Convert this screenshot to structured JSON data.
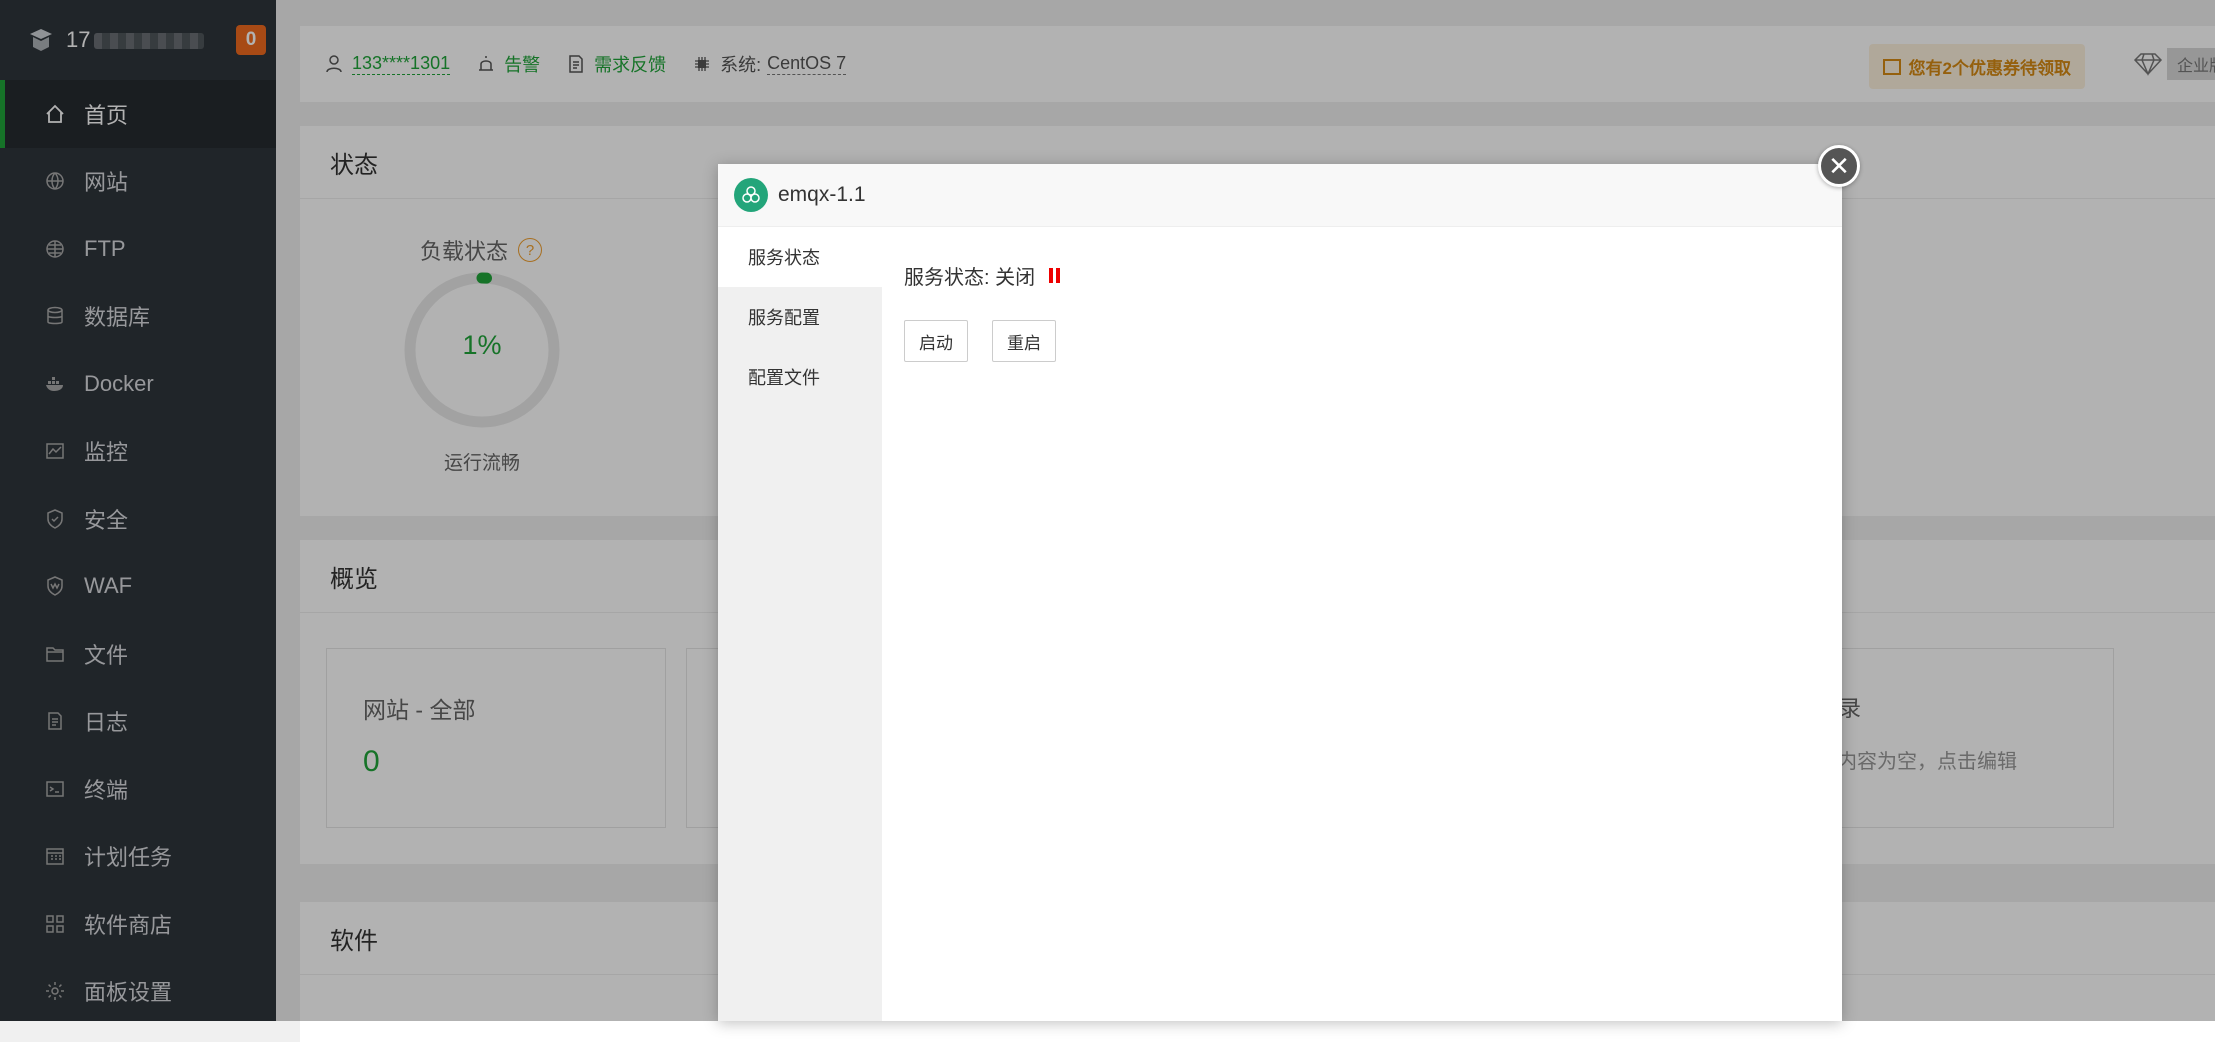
{
  "sidebar": {
    "account_prefix": "17",
    "notification_count": "0",
    "items": [
      {
        "label": "首页",
        "icon": "home-icon"
      },
      {
        "label": "网站",
        "icon": "globe-icon"
      },
      {
        "label": "FTP",
        "icon": "ftp-globe-icon"
      },
      {
        "label": "数据库",
        "icon": "database-icon"
      },
      {
        "label": "Docker",
        "icon": "docker-icon"
      },
      {
        "label": "监控",
        "icon": "monitor-icon"
      },
      {
        "label": "安全",
        "icon": "shield-icon"
      },
      {
        "label": "WAF",
        "icon": "waf-shield-icon"
      },
      {
        "label": "文件",
        "icon": "folder-icon"
      },
      {
        "label": "日志",
        "icon": "log-icon"
      },
      {
        "label": "终端",
        "icon": "terminal-icon"
      },
      {
        "label": "计划任务",
        "icon": "calendar-icon"
      },
      {
        "label": "软件商店",
        "icon": "apps-icon"
      },
      {
        "label": "面板设置",
        "icon": "gear-icon"
      }
    ]
  },
  "topbar": {
    "phone": "133****1301",
    "alarm": "告警",
    "feedback": "需求反馈",
    "system_label": "系统:",
    "system_value": "CentOS 7",
    "coupon": "您有2个优惠券待领取",
    "edition": "企业版"
  },
  "status": {
    "title": "状态",
    "load_label": "负载状态",
    "load_value": "1%",
    "load_percent": 1,
    "load_desc": "运行流畅"
  },
  "overview": {
    "title": "概览",
    "website_label": "网站 - 全部",
    "website_value": "0",
    "memo_title": "忘录",
    "memo_text": "前内容为空，点击编辑"
  },
  "software": {
    "title": "软件"
  },
  "dialog": {
    "title": "emqx-1.1",
    "tabs": [
      "服务状态",
      "服务配置",
      "配置文件"
    ],
    "service_status_label": "服务状态: 关闭",
    "start_button": "启动",
    "restart_button": "重启"
  }
}
